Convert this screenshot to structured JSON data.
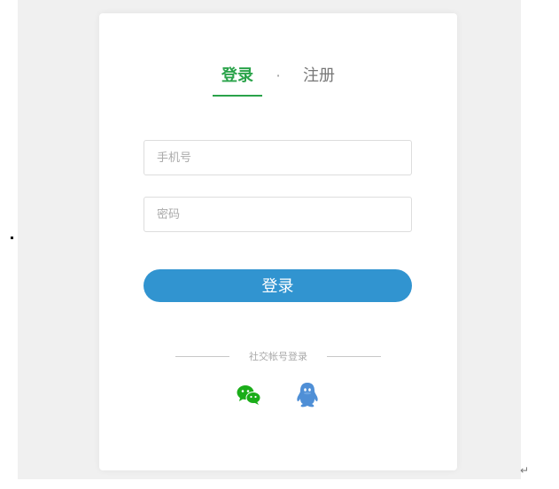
{
  "tabs": {
    "login_label": "登录",
    "separator": "·",
    "register_label": "注册"
  },
  "form": {
    "phone_placeholder": "手机号",
    "password_placeholder": "密码",
    "submit_label": "登录"
  },
  "social": {
    "label": "社交帐号登录",
    "wechat_icon": "wechat-icon",
    "qq_icon": "qq-icon"
  },
  "misc": {
    "return_mark": "↵"
  },
  "colors": {
    "accent_green": "#2aa34a",
    "button_blue": "#3194d0",
    "wechat_green": "#1aad19",
    "qq_blue": "#4f8fd6",
    "background": "#f0f0f0"
  }
}
